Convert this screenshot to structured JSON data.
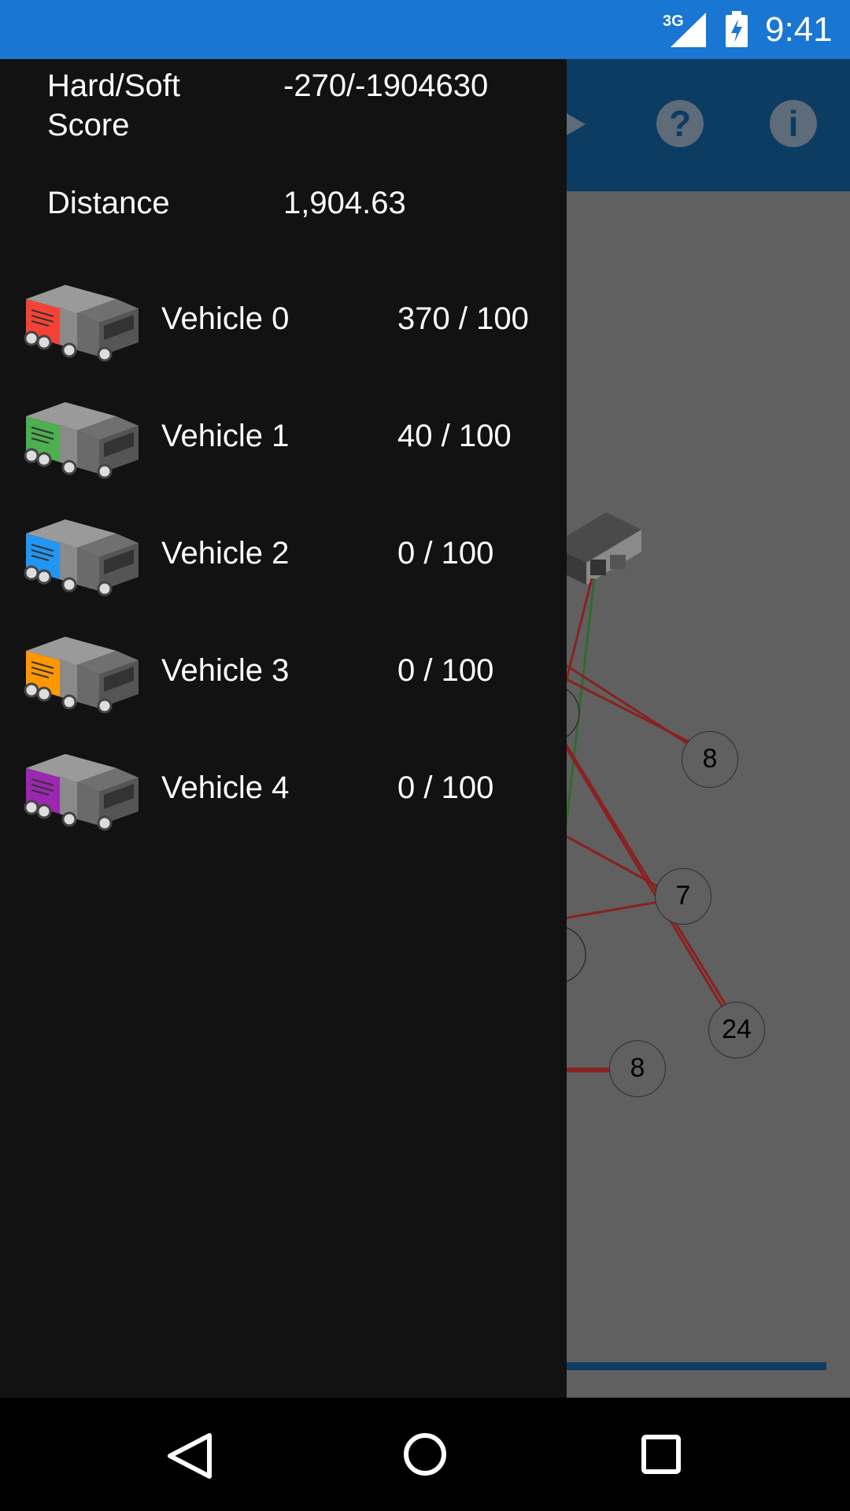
{
  "status_bar": {
    "network": "3G",
    "time": "9:41"
  },
  "drawer": {
    "score": {
      "label": "Hard/Soft Score",
      "value": "-270/-1904630"
    },
    "distance": {
      "label": "Distance",
      "value": "1,904.63"
    },
    "vehicles": [
      {
        "name": "Vehicle 0",
        "load": "370 / 100",
        "color": "#f44336"
      },
      {
        "name": "Vehicle 1",
        "load": "40 / 100",
        "color": "#4caf50"
      },
      {
        "name": "Vehicle 2",
        "load": "0 / 100",
        "color": "#2196f3"
      },
      {
        "name": "Vehicle 3",
        "load": "0 / 100",
        "color": "#ff9800"
      },
      {
        "name": "Vehicle 4",
        "load": "0 / 100",
        "color": "#9c27b0"
      }
    ]
  },
  "map": {
    "nodes": [
      "8",
      "7",
      "24",
      "8"
    ]
  },
  "toolbar": {
    "help_icon": "help-icon",
    "info_icon": "info-icon"
  },
  "colors": {
    "status_bar": "#1976d2",
    "toolbar": "#0d3c63",
    "drawer": "#121212",
    "route_red": "#8b2020",
    "route_green": "#2e6b2e"
  }
}
